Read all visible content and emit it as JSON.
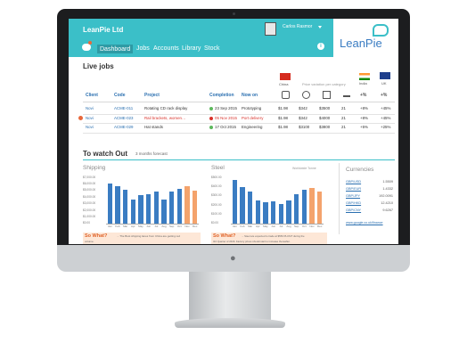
{
  "app": {
    "name": "LeanPie Ltd",
    "user": "Carlos Rasmor",
    "logo_text": "LeanPie",
    "accent": "#3bbfc8"
  },
  "nav": {
    "items": [
      "Dashboard",
      "Jobs",
      "Accounts",
      "Library",
      "Stock"
    ],
    "active": "Dashboard"
  },
  "live_jobs": {
    "title": "Live jobs",
    "columns": [
      "Client",
      "Code",
      "Project",
      "Completion",
      "Now on"
    ],
    "rows": [
      {
        "client": "Novi",
        "code": "ACME-011",
        "project": "Rotating CD rack display",
        "status": "green",
        "completion": "23 Sep 2015",
        "now_on": "Prototyping",
        "v1": "$1.98",
        "v2": "$342",
        "v3": "$3500",
        "v4": "21",
        "india": "+8%",
        "uk": "+45%"
      },
      {
        "client": "Novi",
        "code": "ACME-023",
        "project": "Rail brackets, women…",
        "status": "red",
        "completion": "05 Nov 2015",
        "now_on": "Port delivery",
        "v1": "$1.98",
        "v2": "$342",
        "v3": "$4000",
        "v4": "21",
        "india": "+8%",
        "uk": "+45%"
      },
      {
        "client": "Novi",
        "code": "ACME-029",
        "project": "Hat stands",
        "status": "green",
        "completion": "17 Oct 2015",
        "now_on": "Engineering",
        "v1": "$1.98",
        "v2": "$3100",
        "v3": "$3800",
        "v4": "21",
        "india": "+5%",
        "uk": "+25%"
      }
    ],
    "regions": {
      "china": "China",
      "india": "India",
      "uk": "UK"
    },
    "price_caption": "Price variation per category",
    "pct_label": "+%"
  },
  "watch": {
    "title": "To watch Out",
    "subtitle": "3 months forecast",
    "shipping": {
      "title": "Shipping",
      "y_ticks": [
        "$7,000.00",
        "$6,000.00",
        "$5,000.00",
        "$4,000.00",
        "$3,000.00",
        "$2,000.00",
        "$1,000.00",
        "$0.00"
      ],
      "so_what": "So What?",
      "so_what_text": "... The Bust shipping lanes from China are getting red",
      "so_what_text2": "volume."
    },
    "steel": {
      "title": "Steel",
      "note": "Worldwide Tonne",
      "y_ticks": [
        "$500.00",
        "$400.00",
        "$300.00",
        "$200.00",
        "$100.00",
        "$0.00"
      ],
      "so_what": "So What?",
      "so_what_text": "... Steel are expected to trade at $553 PLUS/T during the",
      "so_what_text2": "3rd Quarter of 2016. Factory prices should start to increase thereafter."
    },
    "month_labels": [
      "Jan",
      "Feb",
      "Mar",
      "Apr",
      "May",
      "Jun",
      "Jul",
      "Aug",
      "Sep",
      "Oct",
      "Nov",
      "Dec"
    ],
    "currencies": {
      "title": "Currencies",
      "rows": [
        {
          "pair": "GBP/USD",
          "value": "1.5509"
        },
        {
          "pair": "GBP/EUR",
          "value": "1.4332"
        },
        {
          "pair": "GBP/JPY",
          "value": "192.0091"
        },
        {
          "pair": "GBP/HKD",
          "value": "12.4210"
        },
        {
          "pair": "GBP/CNY",
          "value": "9.6267"
        }
      ],
      "link": "www.google.co.uk/finance"
    }
  },
  "chart_data": [
    {
      "type": "bar",
      "title": "Shipping",
      "categories": [
        "Jan",
        "Feb",
        "Mar",
        "Apr",
        "May",
        "Jun",
        "Jul",
        "Aug",
        "Sep",
        "Oct",
        "Nov",
        "Dec"
      ],
      "series": [
        {
          "values": [
            6000,
            5600,
            5100,
            3700,
            4300,
            4500,
            4900,
            3600,
            4800,
            5200,
            5600,
            5000
          ]
        }
      ],
      "colors": [
        "#3a7cc2",
        "#3a7cc2",
        "#3a7cc2",
        "#3a7cc2",
        "#3a7cc2",
        "#3a7cc2",
        "#3a7cc2",
        "#3a7cc2",
        "#3a7cc2",
        "#3a7cc2",
        "#f4a36c",
        "#f4a36c"
      ],
      "ylim": [
        0,
        7000
      ]
    },
    {
      "type": "bar",
      "title": "Steel",
      "categories": [
        "Jan",
        "Feb",
        "Mar",
        "Apr",
        "May",
        "Jun",
        "Jul",
        "Aug",
        "Sep",
        "Oct",
        "Nov",
        "Dec"
      ],
      "series": [
        {
          "values": [
            470,
            390,
            350,
            250,
            230,
            240,
            210,
            250,
            320,
            370,
            380,
            350
          ]
        }
      ],
      "colors": [
        "#3a7cc2",
        "#3a7cc2",
        "#3a7cc2",
        "#3a7cc2",
        "#3a7cc2",
        "#3a7cc2",
        "#3a7cc2",
        "#3a7cc2",
        "#3a7cc2",
        "#3a7cc2",
        "#f4a36c",
        "#f4a36c"
      ],
      "ylim": [
        0,
        500
      ]
    }
  ]
}
